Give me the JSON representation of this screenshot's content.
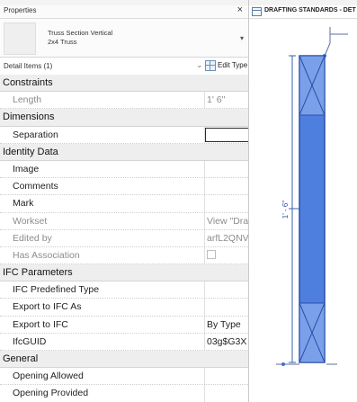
{
  "properties_panel": {
    "title": "Properties",
    "close_glyph": "×",
    "type_selector": {
      "family": "Truss Section Vertical",
      "type": "2x4 Truss",
      "dropdown_glyph": "▾"
    },
    "filter": {
      "selection": "Detail Items (1)",
      "dropdown_glyph": "⌄",
      "edit_type_label": "Edit Type"
    },
    "categories": [
      {
        "name": "Constraints",
        "rows": [
          {
            "label": "Length",
            "value": "1'  6\"",
            "readonly": true
          }
        ]
      },
      {
        "name": "Dimensions",
        "rows": [
          {
            "label": "Separation",
            "value": "",
            "editing": true
          }
        ]
      },
      {
        "name": "Identity Data",
        "rows": [
          {
            "label": "Image",
            "value": ""
          },
          {
            "label": "Comments",
            "value": ""
          },
          {
            "label": "Mark",
            "value": ""
          },
          {
            "label": "Workset",
            "value": "View \"Dra",
            "readonly": true
          },
          {
            "label": "Edited by",
            "value": "arfL2QNV",
            "readonly": true
          },
          {
            "label": "Has Association",
            "value": "",
            "checkbox": true,
            "readonly": true
          }
        ]
      },
      {
        "name": "IFC Parameters",
        "rows": [
          {
            "label": "IFC Predefined Type",
            "value": ""
          },
          {
            "label": "Export to IFC As",
            "value": ""
          },
          {
            "label": "Export to IFC",
            "value": "By Type"
          },
          {
            "label": "IfcGUID",
            "value": "03g$G3X"
          }
        ]
      },
      {
        "name": "General",
        "rows": [
          {
            "label": "Opening Allowed",
            "value": ""
          },
          {
            "label": "Opening Provided",
            "value": ""
          }
        ]
      }
    ]
  },
  "view": {
    "tab_title": "DRAFTING STANDARDS - DET",
    "dimension_label": "1' - 6\"",
    "colors": {
      "selection_blue": "#3f6fd0",
      "selection_light": "#6f97e2",
      "highlight_outline": "#2a4fa8",
      "background": "#ffffff"
    }
  }
}
